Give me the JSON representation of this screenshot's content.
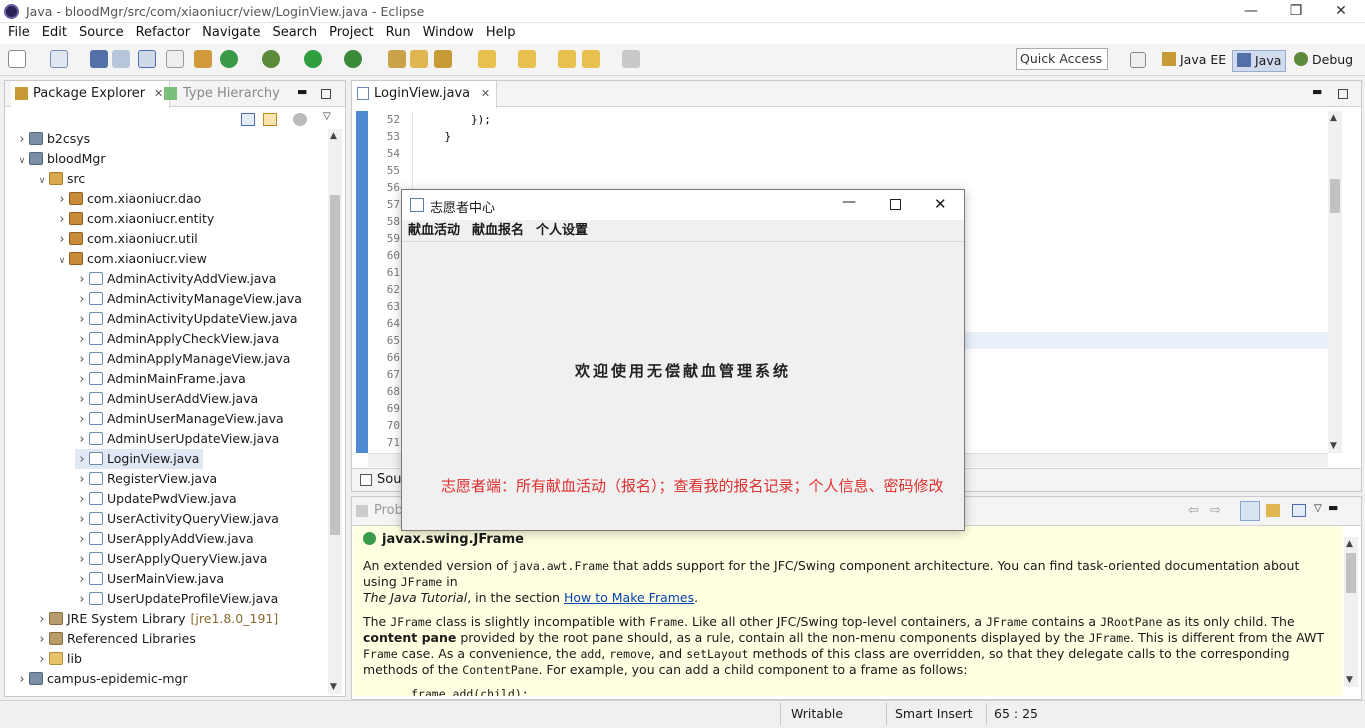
{
  "window": {
    "title": "Java - bloodMgr/src/com/xiaoniucr/view/LoginView.java - Eclipse"
  },
  "menu": [
    "File",
    "Edit",
    "Source",
    "Refactor",
    "Navigate",
    "Search",
    "Project",
    "Run",
    "Window",
    "Help"
  ],
  "toolbar": {
    "quick_access": "Quick Access"
  },
  "perspectives": [
    "Java EE",
    "Java",
    "Debug"
  ],
  "left_panel": {
    "tabs": [
      "Package Explorer",
      "Type Hierarchy"
    ],
    "tree": [
      {
        "label": "b2csys",
        "level": 0,
        "type": "proj",
        "expanded": false
      },
      {
        "label": "bloodMgr",
        "level": 0,
        "type": "proj",
        "expanded": true
      },
      {
        "label": "src",
        "level": 1,
        "type": "src",
        "expanded": true
      },
      {
        "label": "com.xiaoniucr.dao",
        "level": 2,
        "type": "pkg",
        "expanded": false
      },
      {
        "label": "com.xiaoniucr.entity",
        "level": 2,
        "type": "pkg",
        "expanded": false
      },
      {
        "label": "com.xiaoniucr.util",
        "level": 2,
        "type": "pkg",
        "expanded": false
      },
      {
        "label": "com.xiaoniucr.view",
        "level": 2,
        "type": "pkg",
        "expanded": true
      },
      {
        "label": "AdminActivityAddView.java",
        "level": 3,
        "type": "java"
      },
      {
        "label": "AdminActivityManageView.java",
        "level": 3,
        "type": "java"
      },
      {
        "label": "AdminActivityUpdateView.java",
        "level": 3,
        "type": "java"
      },
      {
        "label": "AdminApplyCheckView.java",
        "level": 3,
        "type": "java"
      },
      {
        "label": "AdminApplyManageView.java",
        "level": 3,
        "type": "java"
      },
      {
        "label": "AdminMainFrame.java",
        "level": 3,
        "type": "java"
      },
      {
        "label": "AdminUserAddView.java",
        "level": 3,
        "type": "java"
      },
      {
        "label": "AdminUserManageView.java",
        "level": 3,
        "type": "java"
      },
      {
        "label": "AdminUserUpdateView.java",
        "level": 3,
        "type": "java"
      },
      {
        "label": "LoginView.java",
        "level": 3,
        "type": "java",
        "selected": true
      },
      {
        "label": "RegisterView.java",
        "level": 3,
        "type": "java"
      },
      {
        "label": "UpdatePwdView.java",
        "level": 3,
        "type": "java"
      },
      {
        "label": "UserActivityQueryView.java",
        "level": 3,
        "type": "java"
      },
      {
        "label": "UserApplyAddView.java",
        "level": 3,
        "type": "java"
      },
      {
        "label": "UserApplyQueryView.java",
        "level": 3,
        "type": "java"
      },
      {
        "label": "UserMainView.java",
        "level": 3,
        "type": "java"
      },
      {
        "label": "UserUpdateProfileView.java",
        "level": 3,
        "type": "java"
      },
      {
        "label": "JRE System Library",
        "suffix": "[jre1.8.0_191]",
        "level": 1,
        "type": "lib",
        "expanded": false
      },
      {
        "label": "Referenced Libraries",
        "level": 1,
        "type": "lib",
        "expanded": false
      },
      {
        "label": "lib",
        "level": 1,
        "type": "folder",
        "expanded": false
      },
      {
        "label": "campus-epidemic-mgr",
        "level": 0,
        "type": "proj",
        "expanded": false
      }
    ]
  },
  "editor": {
    "tab": "LoginView.java",
    "lines": [
      {
        "n": "52",
        "code": "        });"
      },
      {
        "n": "53",
        "code": "    }"
      },
      {
        "n": "54",
        "code": ""
      },
      {
        "n": "55",
        "code": ""
      },
      {
        "n": "56",
        "code": ""
      },
      {
        "n": "57",
        "code": ""
      },
      {
        "n": "58",
        "code": ""
      },
      {
        "n": "59",
        "code": ""
      },
      {
        "n": "60",
        "code": ""
      },
      {
        "n": "61",
        "code": ""
      },
      {
        "n": "62",
        "code": ""
      },
      {
        "n": "63",
        "code": ""
      },
      {
        "n": "64",
        "code": ""
      },
      {
        "n": "65",
        "code": ""
      },
      {
        "n": "66",
        "code": ""
      },
      {
        "n": "67",
        "code": ""
      },
      {
        "n": "68",
        "code": ""
      },
      {
        "n": "69",
        "code": ""
      },
      {
        "n": "70",
        "code": ""
      },
      {
        "n": "71",
        "code": ""
      }
    ],
    "bottom_tab": "Sour"
  },
  "doc_panel": {
    "tab": "Prob",
    "title": "javax.swing.JFrame",
    "p1_a": "An extended version of ",
    "p1_code1": "java.awt.Frame",
    "p1_b": " that adds support for the JFC/Swing component architecture. You can find task-oriented documentation about using ",
    "p1_code2": "JFrame",
    "p1_c": " in",
    "p1_italic": "The Java Tutorial",
    "p1_d": ", in the section ",
    "p1_link": "How to Make Frames",
    "p1_e": ".",
    "p2_a": "The ",
    "p2_code1": "JFrame",
    "p2_b": " class is slightly incompatible with ",
    "p2_code2": "Frame",
    "p2_c": ". Like all other JFC/Swing top-level containers, a ",
    "p2_code3": "JFrame",
    "p2_d": " contains a ",
    "p2_code4": "JRootPane",
    "p2_e": " as its only child. The ",
    "p2_bold": "content pane",
    "p2_f": " provided by the root pane should, as a rule, contain all the non-menu components displayed by the ",
    "p2_code5": "JFrame",
    "p2_g": ". This is different from the AWT ",
    "p2_code6": "Frame",
    "p2_h": " case. As a convenience, the ",
    "p2_code7": "add",
    "p2_i": ", ",
    "p2_code8": "remove",
    "p2_j": ", and ",
    "p2_code9": "setLayout",
    "p2_k": " methods of this class are overridden, so that they delegate calls to the corresponding methods of the ",
    "p2_code10": "ContentPane",
    "p2_l": ". For example, you can add a child component to a frame as follows:",
    "code_sample": "frame.add(child);"
  },
  "status": {
    "writable": "Writable",
    "insert": "Smart Insert",
    "position": "65 : 25"
  },
  "swing": {
    "title": "志愿者中心",
    "menus": [
      "献血活动",
      "献血报名",
      "个人设置"
    ],
    "welcome": "欢迎使用无偿献血管理系统"
  },
  "annotation": "志愿者端：所有献血活动（报名）；查看我的报名记录；个人信息、密码修改",
  "colors": {
    "annotation": "#e03030",
    "selection": "#e0e8f4",
    "doc_bg": "#ffffe1"
  }
}
